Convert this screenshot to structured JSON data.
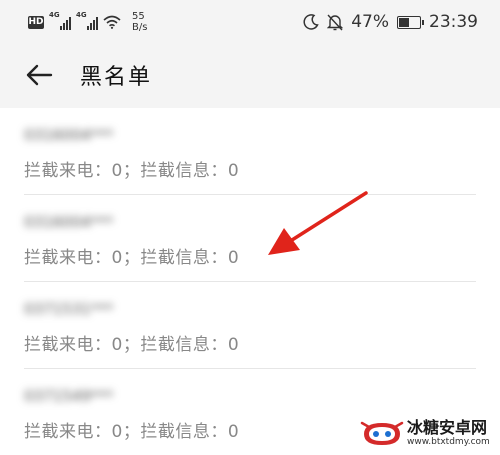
{
  "status_bar": {
    "hd_label": "HD",
    "signal1_label": "4G",
    "signal2_label": "4G",
    "net_speed_value": "55",
    "net_speed_unit": "B/s",
    "battery_percent": "47%",
    "battery_level": 0.47,
    "time": "23:39"
  },
  "header": {
    "title": "黑名单"
  },
  "blacklist": {
    "items": [
      {
        "number": "0316004***",
        "info": "拦截来电：0；拦截信息：0"
      },
      {
        "number": "0316004***",
        "info": "拦截来电：0；拦截信息：0"
      },
      {
        "number": "0371531***",
        "info": "拦截来电：0；拦截信息：0"
      },
      {
        "number": "0371549***",
        "info": "拦截来电：0；拦截信息：0"
      }
    ]
  },
  "watermark": {
    "name": "冰糖安卓网",
    "url": "www.btxtdmy.com"
  },
  "colors": {
    "annotation_arrow": "#e0241b",
    "header_bg": "#f4f4f4"
  }
}
